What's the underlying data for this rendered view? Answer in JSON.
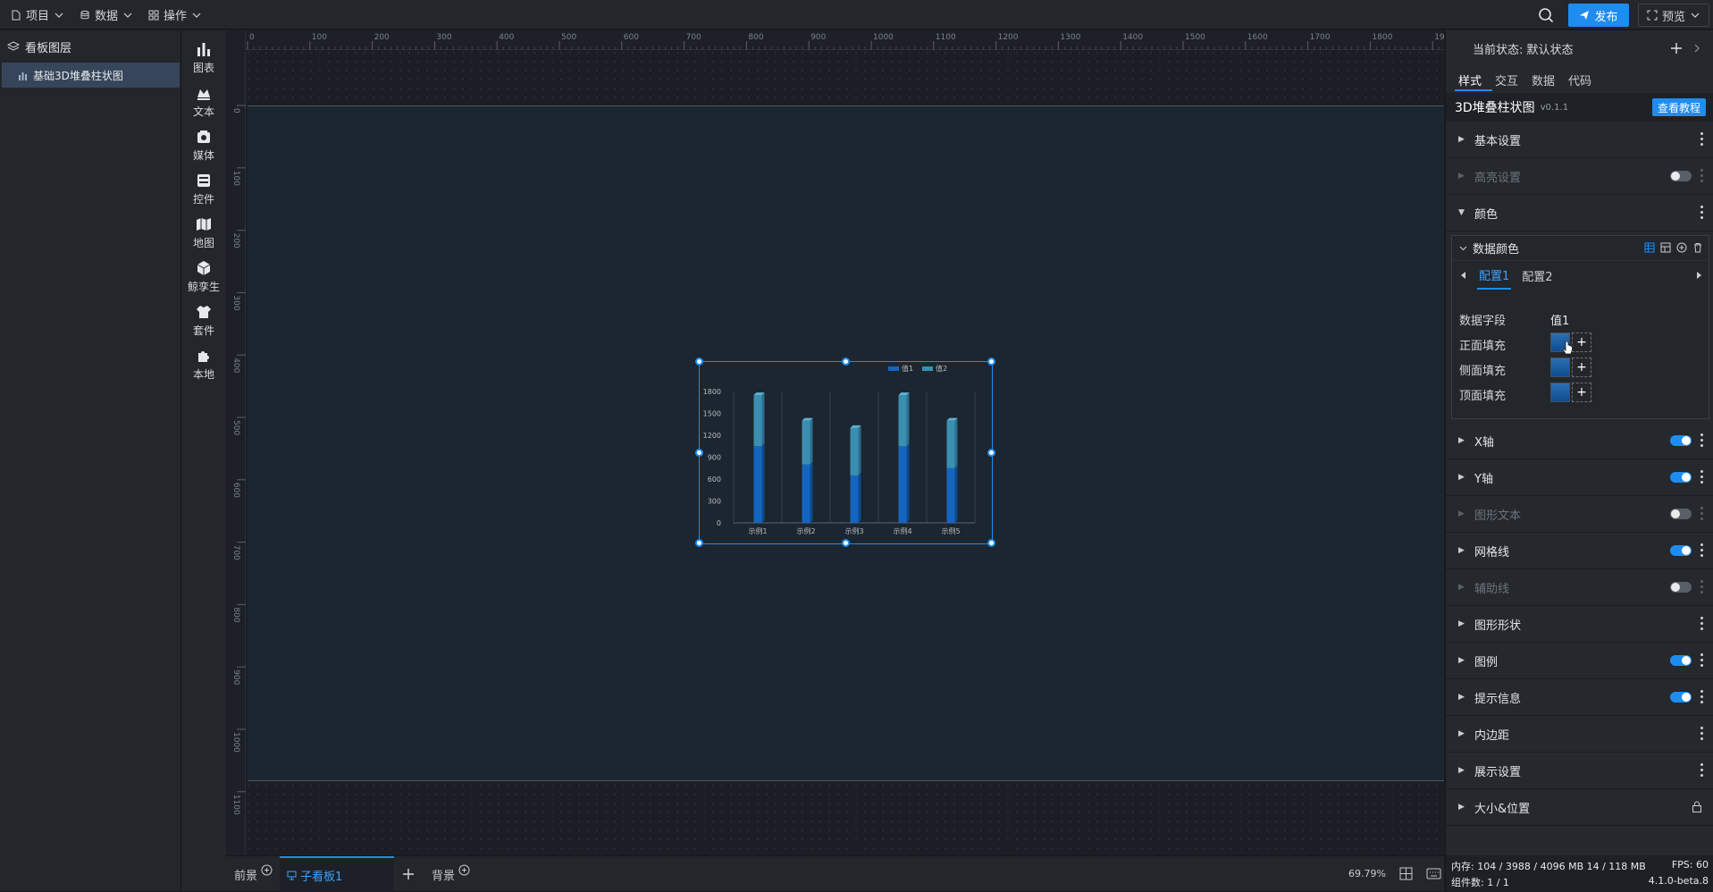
{
  "topbar": {
    "menus": [
      {
        "label": "项目"
      },
      {
        "label": "数据"
      },
      {
        "label": "操作"
      }
    ],
    "publish_label": "发布",
    "preview_label": "预览"
  },
  "layers": {
    "title": "看板图层",
    "items": [
      {
        "label": "基础3D堆叠柱状图"
      }
    ]
  },
  "components": [
    {
      "label": "图表",
      "icon": "bar-chart-icon"
    },
    {
      "label": "文本",
      "icon": "text-icon"
    },
    {
      "label": "媒体",
      "icon": "media-icon"
    },
    {
      "label": "控件",
      "icon": "control-icon"
    },
    {
      "label": "地图",
      "icon": "map-icon"
    },
    {
      "label": "鲸孪生",
      "icon": "twin-cube-icon"
    },
    {
      "label": "套件",
      "icon": "kit-shirt-icon"
    },
    {
      "label": "本地",
      "icon": "local-puzzle-icon"
    }
  ],
  "ruler": {
    "h_ticks": [
      "0",
      "100",
      "200",
      "300",
      "400",
      "500",
      "600",
      "700",
      "800",
      "900",
      "1000",
      "1100",
      "1200",
      "1300",
      "1400",
      "1500",
      "1600",
      "1700",
      "1800",
      "1900"
    ],
    "v_ticks": [
      "0",
      "100",
      "200",
      "300",
      "400",
      "500",
      "600",
      "700",
      "800",
      "900",
      "1000",
      "1100"
    ]
  },
  "chart_data": {
    "type": "bar",
    "stacked": true,
    "three_d": true,
    "categories": [
      "示例1",
      "示例2",
      "示例3",
      "示例4",
      "示例5"
    ],
    "series": [
      {
        "name": "值1",
        "values": [
          1050,
          800,
          650,
          1050,
          750
        ],
        "color": "#1565c0"
      },
      {
        "name": "值2",
        "values": [
          700,
          600,
          650,
          700,
          650
        ],
        "color": "#3a8fb0"
      }
    ],
    "yticks": [
      "1800",
      "1500",
      "1200",
      "900",
      "600",
      "300",
      "0"
    ],
    "ylim": [
      0,
      1800
    ],
    "legend_position": "top-right",
    "grid": true
  },
  "bottom": {
    "tabs": [
      {
        "label": "前景"
      },
      {
        "label": "子看板1"
      },
      {
        "label": "背景"
      }
    ],
    "zoom": "69.79%"
  },
  "props": {
    "state_label": "当前状态: 默认状态",
    "tabs": [
      {
        "label": "样式"
      },
      {
        "label": "交互"
      },
      {
        "label": "数据"
      },
      {
        "label": "代码"
      }
    ],
    "component_title": "3D堆叠柱状图",
    "version": "v0.1.1",
    "tutorial_label": "查看教程",
    "sections_top": [
      {
        "label": "基本设置",
        "dim": false,
        "toggle": null,
        "expanded": false
      },
      {
        "label": "高亮设置",
        "dim": true,
        "toggle": "off",
        "expanded": false
      },
      {
        "label": "颜色",
        "dim": false,
        "toggle": null,
        "expanded": true
      }
    ],
    "data_color": {
      "title": "数据颜色",
      "configs": [
        {
          "label": "配置1"
        },
        {
          "label": "配置2"
        }
      ],
      "field_label": "数据字段",
      "field_value": "值1",
      "fills": [
        {
          "label": "正面填充"
        },
        {
          "label": "侧面填充"
        },
        {
          "label": "顶面填充"
        }
      ]
    },
    "sections_bottom": [
      {
        "label": "X轴",
        "dim": false,
        "toggle": "on"
      },
      {
        "label": "Y轴",
        "dim": false,
        "toggle": "on"
      },
      {
        "label": "图形文本",
        "dim": true,
        "toggle": "off"
      },
      {
        "label": "网格线",
        "dim": false,
        "toggle": "on"
      },
      {
        "label": "辅助线",
        "dim": true,
        "toggle": "off"
      },
      {
        "label": "图形形状",
        "dim": false,
        "toggle": null
      },
      {
        "label": "图例",
        "dim": false,
        "toggle": "on"
      },
      {
        "label": "提示信息",
        "dim": false,
        "toggle": "on"
      },
      {
        "label": "内边距",
        "dim": false,
        "toggle": null
      },
      {
        "label": "展示设置",
        "dim": false,
        "toggle": null
      },
      {
        "label": "大小&位置",
        "dim": false,
        "toggle": null,
        "lock": true
      }
    ],
    "status": {
      "memory": "内存: 104 / 3988 / 4096 MB 14 / 118 MB",
      "fps": "FPS: 60",
      "count": "组件数: 1 / 1",
      "build": "4.1.0-beta.8"
    }
  }
}
